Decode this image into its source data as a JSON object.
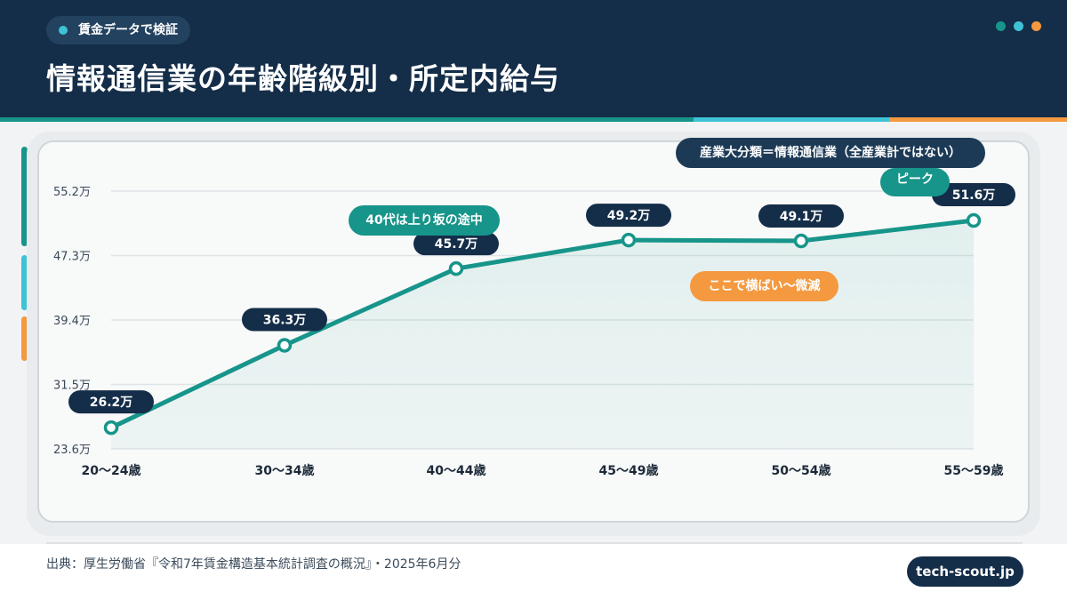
{
  "header": {
    "tag": "賃金データで検証",
    "title": "情報通信業の年齢階級別・所定内給与",
    "colors": {
      "bg": "#142d48",
      "teal": "#17958a",
      "cyan": "#3ec3d6",
      "orange": "#f4993f"
    }
  },
  "annotations": {
    "industry_note": "産業大分類＝情報通信業（全産業計ではない）",
    "forties_note": "40代は上り坂の途中",
    "flat_note": "ここで横ばい〜微減",
    "peak_note": "ピーク"
  },
  "chart_data": {
    "type": "line",
    "categories": [
      "20〜24歳",
      "30〜34歳",
      "40〜44歳",
      "45〜49歳",
      "50〜54歳",
      "55〜59歳"
    ],
    "values": [
      26.2,
      36.3,
      45.7,
      49.2,
      49.1,
      51.6
    ],
    "data_labels": [
      "26.2万",
      "36.3万",
      "45.7万",
      "49.2万",
      "49.1万",
      "51.6万"
    ],
    "yticks": [
      23.6,
      31.5,
      39.4,
      47.3,
      55.2
    ],
    "ytick_labels": [
      "23.6万",
      "31.5万",
      "39.4万",
      "47.3万",
      "55.2万"
    ],
    "ylim": [
      23.6,
      55.2
    ],
    "grid": true,
    "line_color": "#17958a"
  },
  "footer": {
    "source": "出典：厚生労働省『令和7年賃金構造基本統計調査の概況』・2025年6月分",
    "brand": "tech-scout.jp"
  }
}
